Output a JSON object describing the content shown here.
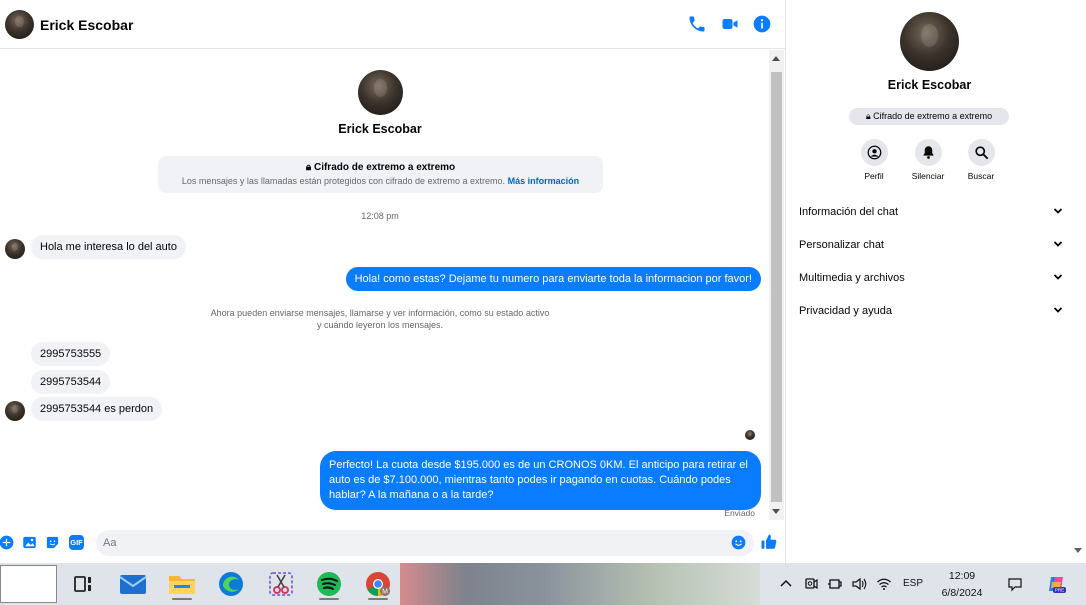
{
  "header": {
    "contact_name": "Erick Escobar"
  },
  "conversation": {
    "contact_name": "Erick Escobar",
    "encryption_title": "Cifrado de extremo a extremo",
    "encryption_text": "Los mensajes y las llamadas están protegidos con cifrado de extremo a extremo.",
    "encryption_link": "Más información",
    "timestamp": "12:08 pm",
    "system_note": "Ahora pueden enviarse mensajes, llamarse y ver información, como su estado activo y cuándo leyeron los mensajes.",
    "messages": [
      {
        "from": "them",
        "text": "Hola me interesa lo del auto"
      },
      {
        "from": "me",
        "text": "Hola! como estas? Dejame tu numero para enviarte toda la informacion por favor!"
      },
      {
        "from": "them",
        "text": "2995753555"
      },
      {
        "from": "them",
        "text": "2995753544"
      },
      {
        "from": "them",
        "text": "2995753544 es perdon"
      },
      {
        "from": "me",
        "text": "Perfecto! La cuota desde $195.000 es de un CRONOS 0KM. El anticipo para retirar el auto es de $7.100.000, mientras tanto podes ir pagando en cuotas. Cuándo podes hablar? A la mañana o a la tarde?"
      }
    ],
    "sent_status": "Enviado"
  },
  "composer": {
    "placeholder": "Aa",
    "gif_label": "GIF"
  },
  "panel": {
    "contact_name": "Erick Escobar",
    "encryption_badge": "Cifrado de extremo a extremo",
    "actions": [
      {
        "label": "Perfil",
        "icon": "profile-icon"
      },
      {
        "label": "Silenciar",
        "icon": "bell-icon"
      },
      {
        "label": "Buscar",
        "icon": "search-icon"
      }
    ],
    "sections": [
      "Información del chat",
      "Personalizar chat",
      "Multimedia y archivos",
      "Privacidad y ayuda"
    ]
  },
  "taskbar": {
    "apps": [
      "task-view",
      "mail",
      "file-explorer",
      "edge",
      "snipping-tool",
      "spotify",
      "chrome"
    ],
    "language": "ESP",
    "time": "12:09",
    "date": "6/8/2024",
    "chrome_profile_letter": "M",
    "copilot_badge": "PRE"
  },
  "colors": {
    "messenger_blue": "#0a7cff",
    "incoming_bubble": "#f0f2f5",
    "secondary_text": "#65676b"
  }
}
